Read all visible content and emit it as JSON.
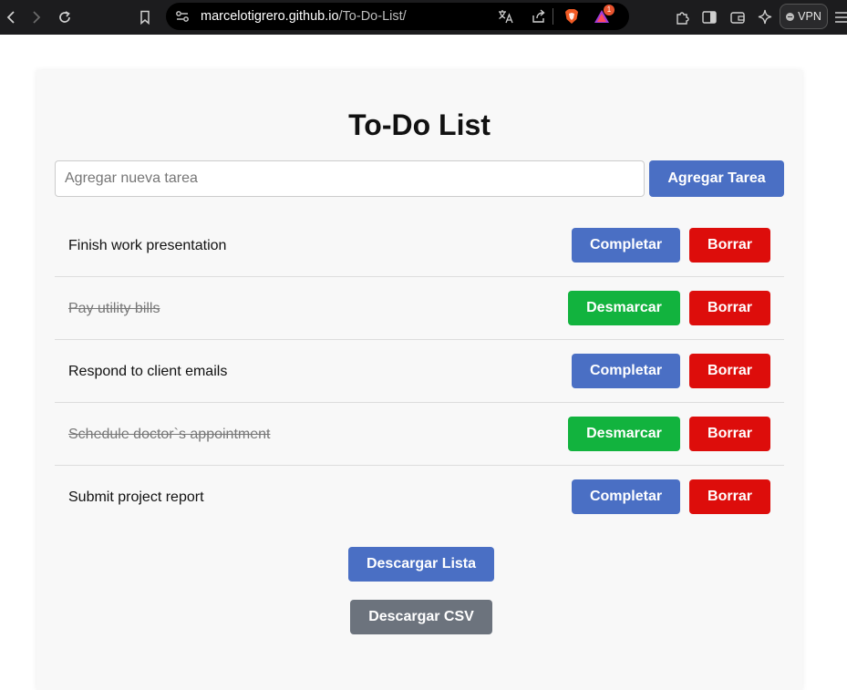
{
  "browser": {
    "url_domain": "marcelotigrero.github.io",
    "url_path": "/To-Do-List/",
    "notification_count": "1",
    "vpn_label": "VPN",
    "icons": [
      "back-icon",
      "forward-icon",
      "reload-icon",
      "bookmark-icon",
      "site-info-icon",
      "translate-icon",
      "share-icon",
      "brave-shields-icon",
      "brave-rewards-icon",
      "extensions-icon",
      "sidebar-icon",
      "wallet-icon",
      "leo-ai-icon",
      "vpn-icon",
      "menu-icon"
    ]
  },
  "app": {
    "title": "To-Do List",
    "input": {
      "placeholder": "Agregar nueva tarea",
      "value": ""
    },
    "add_button": "Agregar Tarea",
    "tasks": [
      {
        "text": "Finish work presentation",
        "completed": false,
        "action_label": "Completar",
        "delete_label": "Borrar"
      },
      {
        "text": "Pay utility bills",
        "completed": true,
        "action_label": "Desmarcar",
        "delete_label": "Borrar"
      },
      {
        "text": "Respond to client emails",
        "completed": false,
        "action_label": "Completar",
        "delete_label": "Borrar"
      },
      {
        "text": "Schedule doctor`s appointment",
        "completed": true,
        "action_label": "Desmarcar",
        "delete_label": "Borrar"
      },
      {
        "text": "Submit project report",
        "completed": false,
        "action_label": "Completar",
        "delete_label": "Borrar"
      }
    ],
    "download_list_button": "Descargar Lista",
    "download_csv_button": "Descargar CSV"
  },
  "colors": {
    "primary": "#4a6fc4",
    "success": "#12b33e",
    "danger": "#dd0d0b",
    "secondary": "#6c737d"
  }
}
